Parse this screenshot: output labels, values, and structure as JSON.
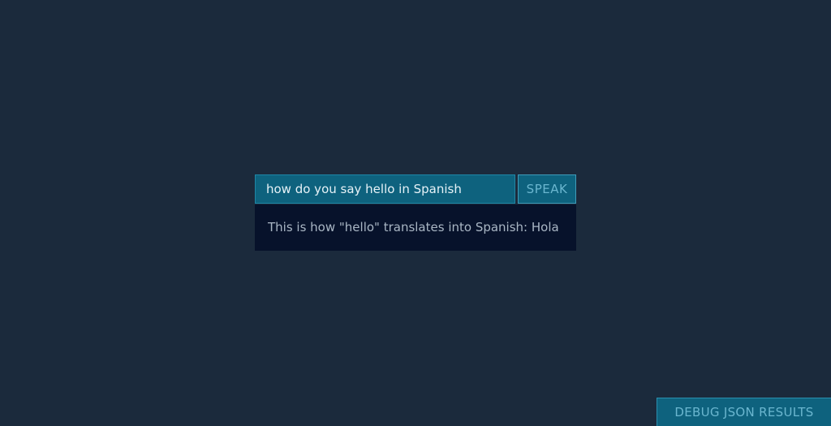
{
  "query": {
    "value": "how do you say hello in Spanish",
    "speak_label": "SPEAK"
  },
  "response": {
    "text": "This is how \"hello\" translates into Spanish: Hola"
  },
  "debug": {
    "label": "DEBUG JSON RESULTS"
  },
  "colors": {
    "background": "#1b2a3c",
    "accent": "#0e627e",
    "response_background": "#07122b"
  }
}
